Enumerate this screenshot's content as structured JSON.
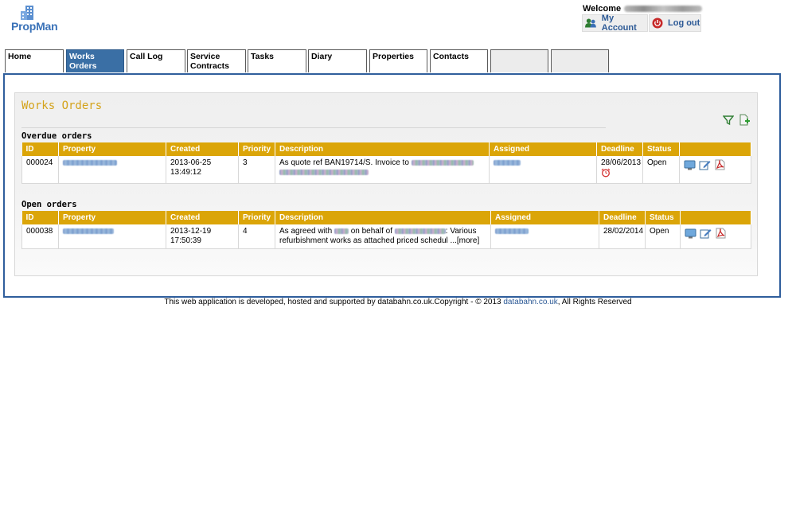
{
  "app": {
    "logo_text": "PropMan"
  },
  "header": {
    "welcome_label": "Welcome",
    "my_account_label": "My Account",
    "logout_label": "Log out"
  },
  "tabs": [
    {
      "label": "Home"
    },
    {
      "label": "Works Orders"
    },
    {
      "label": "Call Log"
    },
    {
      "label": "Service Contracts"
    },
    {
      "label": "Tasks"
    },
    {
      "label": "Diary"
    },
    {
      "label": "Properties"
    },
    {
      "label": "Contacts"
    },
    {
      "label": ""
    },
    {
      "label": ""
    }
  ],
  "page": {
    "title": "Works Orders"
  },
  "overdue": {
    "title": "Overdue orders",
    "columns": [
      "ID",
      "Property",
      "Created",
      "Priority",
      "Description",
      "Assigned",
      "Deadline",
      "Status"
    ],
    "rows": [
      {
        "id": "000024",
        "created_date": "2013-06-25",
        "created_time": "13:49:12",
        "priority": "3",
        "description_start": "As quote ref BAN19714/S. Invoice to",
        "deadline": "28/06/2013",
        "status": "Open"
      }
    ]
  },
  "open": {
    "title": "Open orders",
    "columns": [
      "ID",
      "Property",
      "Created",
      "Priority",
      "Description",
      "Assigned",
      "Deadline",
      "Status"
    ],
    "rows": [
      {
        "id": "000038",
        "created_date": "2013-12-19",
        "created_time": "17:50:39",
        "priority": "4",
        "description_part1": "As agreed with",
        "description_part2": "on behalf of",
        "description_part3": ": Various",
        "description_line2": "refurbishment works as attached priced schedul ...",
        "more_label": "[more]",
        "deadline": "28/02/2014",
        "status": "Open"
      }
    ]
  },
  "footer": {
    "text": "This web application is developed, hosted and supported by databahn.co.uk.Copyright - © 2013",
    "link_text": "databahn.co.uk",
    "suffix": ", All Rights Reserved"
  },
  "colors": {
    "accent": "#dba508",
    "brand": "#2f5e9c",
    "title": "#d4a31a",
    "active_tab": "#3a6fa5"
  },
  "icons": [
    "building-icon",
    "users-icon",
    "power-icon",
    "filter-icon",
    "add-document-icon",
    "monitor-icon",
    "edit-icon",
    "pdf-icon",
    "alarm-clock-icon"
  ]
}
